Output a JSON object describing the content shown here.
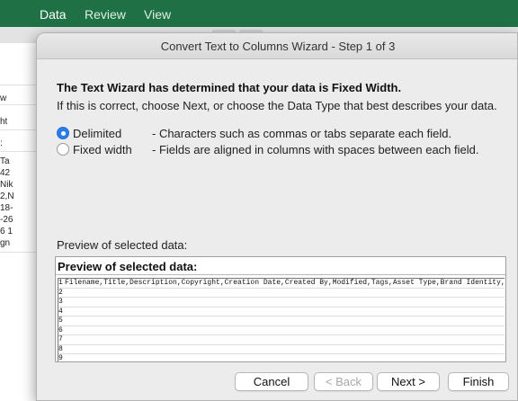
{
  "ribbon": {
    "tabs": [
      "Data",
      "Review",
      "View"
    ]
  },
  "sheet": {
    "cells": [
      "w",
      "ht",
      ":",
      "Ta",
      "42",
      "Nik",
      "2,N",
      "18-",
      "-26",
      "6 1",
      "gn"
    ]
  },
  "dialog": {
    "title": "Convert Text to Columns Wizard - Step 1 of 3",
    "heading": "The Text Wizard has determined that your data is Fixed Width.",
    "instruction": "If this is correct, choose Next, or choose the Data Type that best describes your data.",
    "options": [
      {
        "label": "Delimited",
        "description": "- Characters such as commas or tabs separate each field.",
        "checked": true
      },
      {
        "label": "Fixed width",
        "description": "- Fields are aligned in columns with spaces between each field.",
        "checked": false
      }
    ],
    "preview_caption": "Preview of selected data:",
    "preview_header": "Preview of selected data:",
    "preview_lines": [
      {
        "n": "1",
        "text": "Filename,Title,Description,Copyright,Creation Date,Created By,Modified,Tags,Asset Type,Brand Identity,Bra"
      },
      {
        "n": "2",
        "text": ""
      },
      {
        "n": "3",
        "text": ""
      },
      {
        "n": "4",
        "text": ""
      },
      {
        "n": "5",
        "text": ""
      },
      {
        "n": "6",
        "text": ""
      },
      {
        "n": "7",
        "text": ""
      },
      {
        "n": "8",
        "text": ""
      },
      {
        "n": "9",
        "text": ""
      }
    ],
    "buttons": {
      "cancel": "Cancel",
      "back": "< Back",
      "next": "Next >",
      "finish": "Finish"
    }
  }
}
